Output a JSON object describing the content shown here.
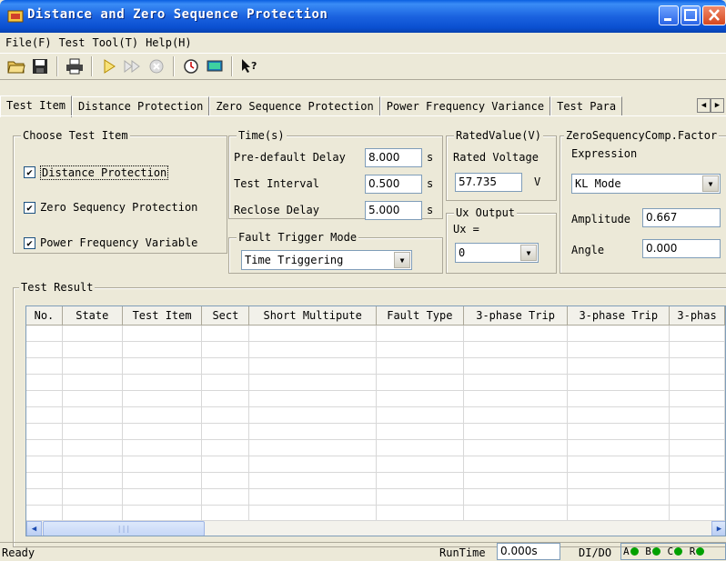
{
  "window": {
    "title": "Distance and Zero Sequence Protection"
  },
  "menu": [
    "File(F)",
    "Test",
    "Tool(T)",
    "Help(H)"
  ],
  "toolbar_icons": [
    "open-folder-icon",
    "save-icon",
    "print-icon",
    "play-icon",
    "fast-forward-icon",
    "stop-icon",
    "clock-icon",
    "monitor-icon",
    "help-pointer-icon"
  ],
  "tabs": [
    "Test Item",
    "Distance Protection",
    "Zero Sequence Protection",
    "Power Frequency Variance",
    "Test Para"
  ],
  "choose_test_item": {
    "title": "Choose Test Item",
    "items": [
      {
        "label": "Distance Protection",
        "checked": true
      },
      {
        "label": "Zero Sequency  Protection",
        "checked": true
      },
      {
        "label": "Power Frequency Variable",
        "checked": true
      }
    ]
  },
  "time": {
    "title": "Time(s)",
    "pre_default_delay": {
      "label": "Pre-default Delay",
      "value": "8.000",
      "unit": "s"
    },
    "test_interval": {
      "label": "Test Interval",
      "value": "0.500",
      "unit": "s"
    },
    "reclose_delay": {
      "label": "Reclose Delay",
      "value": "5.000",
      "unit": "s"
    }
  },
  "fault_trigger": {
    "title": "Fault Trigger Mode",
    "selected": "Time Triggering"
  },
  "rated_value": {
    "title": "RatedValue(V)",
    "label": "Rated Voltage",
    "value": "57.735",
    "unit": "V"
  },
  "ux_output": {
    "title": "Ux Output",
    "label": "Ux =",
    "selected": "0"
  },
  "zero_seq": {
    "title": "ZeroSequencyComp.Factor",
    "expression_label": "Expression",
    "expression": "KL Mode",
    "amplitude_label": "Amplitude",
    "amplitude": "0.667",
    "angle_label": "Angle",
    "angle": "0.000"
  },
  "test_result": {
    "title": "Test Result",
    "columns": [
      "No.",
      "State",
      "Test Item",
      "Sect",
      "Short Multipute",
      "Fault Type",
      "3-phase Trip",
      "3-phase Trip",
      "3-phas"
    ],
    "row_count": 12,
    "scroll_grip": "|||"
  },
  "status": {
    "ready": "Ready",
    "runtime_label": "RunTime",
    "runtime_value": "0.000s",
    "dido_label": "DI/DO",
    "leds": [
      "A",
      "B",
      "C",
      "R"
    ]
  },
  "colors": {
    "titlebar": "#0a4fd0",
    "face": "#ece9d8",
    "led": "#00a000",
    "close": "#d6481f"
  }
}
